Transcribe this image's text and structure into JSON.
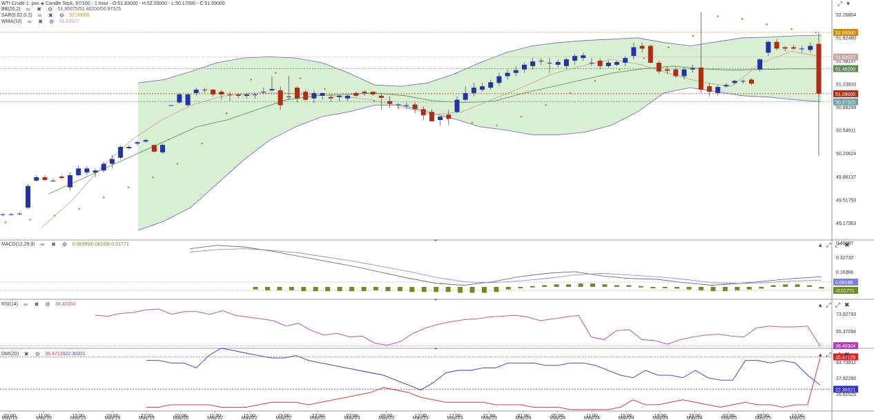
{
  "header": {
    "main": "WTI Crude 1: pos  ◈  Candle Stick, 97/100 - 1 hour - O:51.83000 - H:52.00000 - L:50.17000 - C:51.09000",
    "bb_label": "BB(20,2)",
    "bb_values": "51.95675/51.46200/50.97325",
    "sar_label": "SAR(0.02,0.2)",
    "sar_value": "52.00000",
    "wma_label": "WMA(10)",
    "wma_value": "51.63527"
  },
  "macd_header": {
    "label": "MACD(12,26,9)",
    "values": "0.06399/0.08169/-0.01771"
  },
  "rsi_header": {
    "label": "RSI(14)",
    "value": "38.40304"
  },
  "dmi_header": {
    "label": "DMI(20)",
    "plus": "35.47129",
    "minus": "22.30321"
  },
  "colors": {
    "bull": "#2233aa",
    "bear": "#b52a12",
    "band_fill": "#d9efd1",
    "band_line": "#6a5fc9",
    "mid": "#5a8a4c",
    "wma": "#c7a7a0",
    "sar": "#d18a00",
    "macd_hist": "#6b8e1e",
    "macd": "#5a5a5a",
    "signal": "#7e7ee0",
    "rsi": "#b23cb4",
    "dmi_plus": "#3030d0",
    "dmi_minus": "#e02020"
  },
  "chart_data": [
    {
      "type": "candlestick",
      "title": "WTI Crude 1: pos",
      "ylim": [
        49.0,
        52.42
      ],
      "y_ticks": [
        "52.26804",
        "51.92480",
        "51.58157",
        "51.23833",
        "50.89299",
        "50.54911",
        "50.20624",
        "49.86137",
        "49.51753",
        "49.17363"
      ],
      "x_ticks": [
        {
          "time": "03:00",
          "date": "May/19"
        },
        {
          "time": "11:00",
          "date": "May/19"
        },
        {
          "time": "15:00",
          "date": "May/19"
        },
        {
          "time": "19:00",
          "date": "May/19"
        },
        {
          "time": "23:00",
          "date": "May/19"
        },
        {
          "time": "03:00",
          "date": "May/20"
        },
        {
          "time": "11:00",
          "date": "May/22"
        },
        {
          "time": "15:00",
          "date": "May/22"
        },
        {
          "time": "19:00",
          "date": "May/22"
        },
        {
          "time": "23:00",
          "date": "May/22"
        },
        {
          "time": "03:00",
          "date": "May/23"
        },
        {
          "time": "09:00",
          "date": "May/23"
        },
        {
          "time": "13:00",
          "date": "May/23"
        },
        {
          "time": "17:00",
          "date": "May/23"
        },
        {
          "time": "21:00",
          "date": "May/23"
        },
        {
          "time": "01:00",
          "date": "May/24"
        },
        {
          "time": "05:00",
          "date": "May/24"
        },
        {
          "time": "11:00",
          "date": "May/24"
        },
        {
          "time": "15:00",
          "date": "May/24"
        },
        {
          "time": "19:00",
          "date": "May/24"
        },
        {
          "time": "23:00",
          "date": "May/24"
        },
        {
          "time": "03:00",
          "date": "May/25"
        },
        {
          "time": "09:00",
          "date": "May/25"
        },
        {
          "time": "13:00",
          "date": "May/25"
        }
      ],
      "price_tags": [
        {
          "label": "52.00000",
          "value": 52.0,
          "color": "#d18a00"
        },
        {
          "label": "51.63527",
          "value": 51.635,
          "color": "#c7a7a0"
        },
        {
          "label": "51.46200",
          "value": 51.462,
          "color": "#5a8a4c"
        },
        {
          "label": "51.09000",
          "value": 51.09,
          "color": "#b52a12"
        },
        {
          "label": "50.97325",
          "value": 50.97,
          "color": "#6aa0a8"
        }
      ],
      "candles": [
        [
          49.3,
          49.32,
          49.27,
          49.3
        ],
        [
          49.3,
          49.32,
          49.28,
          49.3
        ],
        [
          49.31,
          49.33,
          49.29,
          49.31
        ],
        [
          49.4,
          49.75,
          49.38,
          49.72
        ],
        [
          49.8,
          49.88,
          49.78,
          49.85
        ],
        [
          49.85,
          49.88,
          49.8,
          49.81
        ],
        [
          49.8,
          49.83,
          49.78,
          49.8
        ],
        [
          49.86,
          49.88,
          49.82,
          49.84
        ],
        [
          49.7,
          49.92,
          49.65,
          49.88
        ],
        [
          49.88,
          50.02,
          49.86,
          49.98
        ],
        [
          49.92,
          50.02,
          49.88,
          49.98
        ],
        [
          49.92,
          49.98,
          49.85,
          49.95
        ],
        [
          49.95,
          50.08,
          49.92,
          50.05
        ],
        [
          50.05,
          50.18,
          49.98,
          50.12
        ],
        [
          50.14,
          50.32,
          50.12,
          50.3
        ],
        [
          50.28,
          50.33,
          50.26,
          50.3
        ],
        [
          50.35,
          50.39,
          50.32,
          50.37
        ],
        [
          50.38,
          50.42,
          50.36,
          50.4
        ],
        [
          50.33,
          50.3,
          50.22,
          50.23
        ],
        [
          50.22,
          50.35,
          50.2,
          50.33
        ],
        [
          50.92,
          50.92,
          50.92,
          50.92
        ],
        [
          50.96,
          51.1,
          50.94,
          51.08
        ],
        [
          50.92,
          51.1,
          50.9,
          51.08
        ],
        [
          51.1,
          51.18,
          51.06,
          51.15
        ],
        [
          51.15,
          51.18,
          51.1,
          51.14
        ],
        [
          51.15,
          51.16,
          51.05,
          51.08
        ],
        [
          51.12,
          51.14,
          51.0,
          51.08
        ],
        [
          51.08,
          51.12,
          50.98,
          51.07
        ],
        [
          51.08,
          51.1,
          51.02,
          51.06
        ],
        [
          51.06,
          51.1,
          51.02,
          51.08
        ],
        [
          51.08,
          51.1,
          51.02,
          51.08
        ],
        [
          51.12,
          51.18,
          51.08,
          51.12
        ],
        [
          51.14,
          51.35,
          51.12,
          51.16
        ],
        [
          51.14,
          51.2,
          50.85,
          50.92
        ],
        [
          51.05,
          51.35,
          51.0,
          51.05
        ],
        [
          51.18,
          51.2,
          50.96,
          51.02
        ],
        [
          51.12,
          51.15,
          50.98,
          51.0
        ],
        [
          51.02,
          51.14,
          50.95,
          51.1
        ],
        [
          51.06,
          51.1,
          51.0,
          51.1
        ],
        [
          51.04,
          51.08,
          50.97,
          51.02
        ],
        [
          51.04,
          51.08,
          50.98,
          51.06
        ],
        [
          51.02,
          51.08,
          50.98,
          51.06
        ],
        [
          51.1,
          51.12,
          51.04,
          51.06
        ],
        [
          51.12,
          51.14,
          51.06,
          51.1
        ],
        [
          51.12,
          51.12,
          51.06,
          51.08
        ],
        [
          51.06,
          51.1,
          50.85,
          51.03
        ],
        [
          50.98,
          51.05,
          50.88,
          50.94
        ],
        [
          50.92,
          50.95,
          50.88,
          50.93
        ],
        [
          50.92,
          50.96,
          50.86,
          50.92
        ],
        [
          50.93,
          50.96,
          50.8,
          50.86
        ],
        [
          50.86,
          50.9,
          50.7,
          50.77
        ],
        [
          50.82,
          50.86,
          50.68,
          50.68
        ],
        [
          50.7,
          50.76,
          50.62,
          50.75
        ],
        [
          50.78,
          50.85,
          50.62,
          50.72
        ],
        [
          50.82,
          51.05,
          50.8,
          51.0
        ],
        [
          51.0,
          51.2,
          50.98,
          51.1
        ],
        [
          51.1,
          51.25,
          51.05,
          51.18
        ],
        [
          51.15,
          51.25,
          51.12,
          51.2
        ],
        [
          51.18,
          51.3,
          51.15,
          51.26
        ],
        [
          51.25,
          51.4,
          51.2,
          51.35
        ],
        [
          51.35,
          51.45,
          51.3,
          51.4
        ],
        [
          51.4,
          51.5,
          51.35,
          51.44
        ],
        [
          51.45,
          51.55,
          51.4,
          51.52
        ],
        [
          51.5,
          51.62,
          51.45,
          51.57
        ],
        [
          51.58,
          51.62,
          51.52,
          51.58
        ],
        [
          51.55,
          51.62,
          51.4,
          51.55
        ],
        [
          51.52,
          51.6,
          51.48,
          51.56
        ],
        [
          51.5,
          51.62,
          51.45,
          51.6
        ],
        [
          51.58,
          51.68,
          51.52,
          51.65
        ],
        [
          51.62,
          51.7,
          51.58,
          51.66
        ],
        [
          51.55,
          51.62,
          51.5,
          51.55
        ],
        [
          51.58,
          51.62,
          51.45,
          51.5
        ],
        [
          51.5,
          51.58,
          51.48,
          51.55
        ],
        [
          51.52,
          51.58,
          51.5,
          51.56
        ],
        [
          51.55,
          51.65,
          51.5,
          51.62
        ],
        [
          51.65,
          51.85,
          51.6,
          51.78
        ],
        [
          51.8,
          51.85,
          51.7,
          51.76
        ],
        [
          51.8,
          51.82,
          51.55,
          51.55
        ],
        [
          51.55,
          51.58,
          51.38,
          51.42
        ],
        [
          51.45,
          51.5,
          51.38,
          51.43
        ],
        [
          51.45,
          51.48,
          51.32,
          51.35
        ],
        [
          51.35,
          51.48,
          51.3,
          51.45
        ],
        [
          51.45,
          51.52,
          51.4,
          51.47
        ],
        [
          51.48,
          52.3,
          51.1,
          51.15
        ],
        [
          51.2,
          51.25,
          51.05,
          51.12
        ],
        [
          51.1,
          51.22,
          51.06,
          51.19
        ],
        [
          51.2,
          51.25,
          51.18,
          51.22
        ],
        [
          51.25,
          51.3,
          51.22,
          51.28
        ],
        [
          51.28,
          51.3,
          51.24,
          51.28
        ],
        [
          51.3,
          51.32,
          51.22,
          51.24
        ],
        [
          51.45,
          51.62,
          51.42,
          51.6
        ],
        [
          51.7,
          51.88,
          51.65,
          51.86
        ],
        [
          51.86,
          51.9,
          51.74,
          51.76
        ],
        [
          51.78,
          51.8,
          51.72,
          51.76
        ],
        [
          51.78,
          51.82,
          51.74,
          51.76
        ],
        [
          51.76,
          51.8,
          51.7,
          51.76
        ],
        [
          51.74,
          51.85,
          51.7,
          51.8
        ],
        [
          51.83,
          52.0,
          50.17,
          51.09
        ]
      ],
      "bollinger_upper": [
        51.25,
        51.3,
        51.42,
        51.55,
        51.62,
        51.64,
        51.62,
        51.55,
        51.4,
        51.22,
        51.2,
        51.25,
        51.38,
        51.55,
        51.7,
        51.8,
        51.85,
        51.88,
        51.9,
        51.92,
        51.85,
        51.8,
        51.86,
        51.92,
        51.93,
        51.95,
        51.96
      ],
      "bollinger_mid": [
        49.6,
        49.8,
        50.0,
        50.2,
        50.4,
        50.6,
        50.7,
        50.85,
        51.0,
        51.06,
        51.08,
        51.1,
        51.06,
        50.98,
        50.96,
        50.98,
        51.1,
        51.2,
        51.3,
        51.4,
        51.46,
        51.5,
        51.46,
        51.44,
        51.45,
        51.46,
        51.46
      ],
      "bollinger_lower": [
        49.06,
        49.2,
        49.4,
        49.75,
        50.1,
        50.4,
        50.6,
        50.75,
        50.82,
        50.92,
        50.92,
        50.82,
        50.72,
        50.6,
        50.55,
        50.48,
        50.48,
        50.52,
        50.62,
        50.82,
        51.1,
        51.18,
        51.12,
        51.06,
        51.04,
        51.0,
        50.97
      ],
      "wma": [
        49.1,
        49.5,
        50.0,
        50.4,
        50.7,
        50.92,
        51.05,
        51.1,
        51.1,
        51.08,
        51.05,
        51.0,
        50.9,
        50.78,
        50.82,
        51.0,
        51.18,
        51.38,
        51.5,
        51.6,
        51.52,
        51.38,
        51.26,
        51.2,
        51.55,
        51.72,
        51.64
      ],
      "sar": [
        49.18,
        49.22,
        49.28,
        49.38,
        49.55,
        49.7,
        49.85,
        50.05,
        50.35,
        50.8,
        51.3,
        51.4,
        51.32,
        51.16,
        51.05,
        50.98,
        50.88,
        50.8,
        50.72,
        50.66,
        50.62,
        50.75,
        50.92,
        51.1,
        51.28,
        51.45,
        51.62,
        51.78,
        51.95,
        52.24,
        52.2,
        52.12,
        52.05,
        52.0
      ]
    },
    {
      "type": "macd",
      "title": "MACD(12,26,9)",
      "y_ticks": [
        "0.49097",
        "0.32732",
        "0.16366"
      ],
      "value_tags": [
        {
          "label": "0.08168",
          "color": "#7e7ee0"
        },
        {
          "label": "-0.01771",
          "color": "#6b8e1e"
        }
      ],
      "macd": [
        0.45,
        0.49,
        0.47,
        0.42,
        0.36,
        0.3,
        0.24,
        0.17,
        0.1,
        0.04,
        0.02,
        0.06,
        0.12,
        0.16,
        0.18,
        0.13,
        0.1,
        0.09,
        0.05,
        0.02,
        0.04,
        0.07,
        0.1,
        0.12
      ],
      "signal": [
        0.41,
        0.44,
        0.45,
        0.43,
        0.4,
        0.35,
        0.3,
        0.24,
        0.18,
        0.11,
        0.06,
        0.05,
        0.07,
        0.1,
        0.14,
        0.16,
        0.14,
        0.12,
        0.09,
        0.05,
        0.04,
        0.05,
        0.07,
        0.08
      ],
      "histogram": [
        -0.03,
        -0.04,
        -0.04,
        -0.04,
        -0.05,
        -0.05,
        -0.05,
        -0.05,
        -0.05,
        -0.05,
        -0.04,
        -0.05,
        -0.05,
        -0.06,
        -0.06,
        -0.06,
        -0.06,
        -0.07,
        -0.07,
        -0.07,
        -0.06,
        -0.03,
        -0.01,
        0.01,
        0.02,
        0.03,
        0.03,
        0.04,
        0.04,
        0.03,
        0.02,
        0.02,
        0.01,
        0.0,
        -0.01,
        -0.02,
        -0.03,
        -0.04,
        -0.05,
        -0.05,
        -0.04,
        -0.03,
        -0.02,
        0.02,
        0.03,
        0.03,
        0.02,
        -0.02
      ]
    },
    {
      "type": "line",
      "title": "RSI(14)",
      "y_ticks": [
        "73.82793",
        "55.37094"
      ],
      "value_tags": [
        {
          "label": "38.40304",
          "color": "#b23cb4"
        }
      ],
      "rsi": [
        72,
        71,
        74,
        75,
        78,
        79,
        73,
        76,
        76,
        73,
        77,
        72,
        70,
        68,
        66,
        60,
        63,
        55,
        50,
        52,
        48,
        49,
        41,
        39,
        43,
        52,
        58,
        62,
        65,
        67,
        68,
        70,
        71,
        72,
        70,
        66,
        68,
        70,
        72,
        48,
        45,
        55,
        56,
        45,
        44,
        40,
        45,
        48,
        50,
        51,
        49,
        48,
        58,
        60,
        59,
        59,
        60,
        38
      ],
      "ylim": [
        37,
        85
      ]
    },
    {
      "type": "line",
      "title": "DMI(20)",
      "y_ticks": [
        "33.73912",
        "27.92280",
        "16.61525"
      ],
      "value_tags": [
        {
          "label": "35.47129",
          "color": "#e02020"
        },
        {
          "label": "22.30321",
          "color": "#3030d0"
        }
      ],
      "dmi_plus": [
        34,
        34,
        33,
        33,
        31,
        36,
        39,
        38,
        37,
        36,
        35,
        35,
        36,
        34,
        33,
        32,
        31,
        30,
        29,
        28,
        26,
        24,
        22,
        25,
        29,
        30,
        30,
        31,
        31,
        33,
        33,
        33,
        32,
        32,
        33,
        33,
        32,
        30,
        28,
        27,
        30,
        28,
        28,
        27,
        30,
        27,
        26,
        26,
        34,
        34,
        33,
        34,
        33,
        28,
        24
      ],
      "dmi_minus": [
        15,
        15,
        16,
        16,
        16,
        16,
        15,
        15,
        15,
        16,
        17,
        17,
        17,
        16,
        17,
        18,
        19,
        20,
        21,
        23,
        22,
        21,
        19,
        18,
        17,
        17,
        17,
        17,
        16,
        16,
        16,
        15,
        15,
        15,
        14,
        14,
        14,
        14,
        15,
        18,
        16,
        16,
        17,
        18,
        17,
        16,
        15,
        16,
        17,
        16,
        16,
        15,
        16,
        16,
        35
      ],
      "ylim": [
        14,
        37
      ]
    }
  ]
}
